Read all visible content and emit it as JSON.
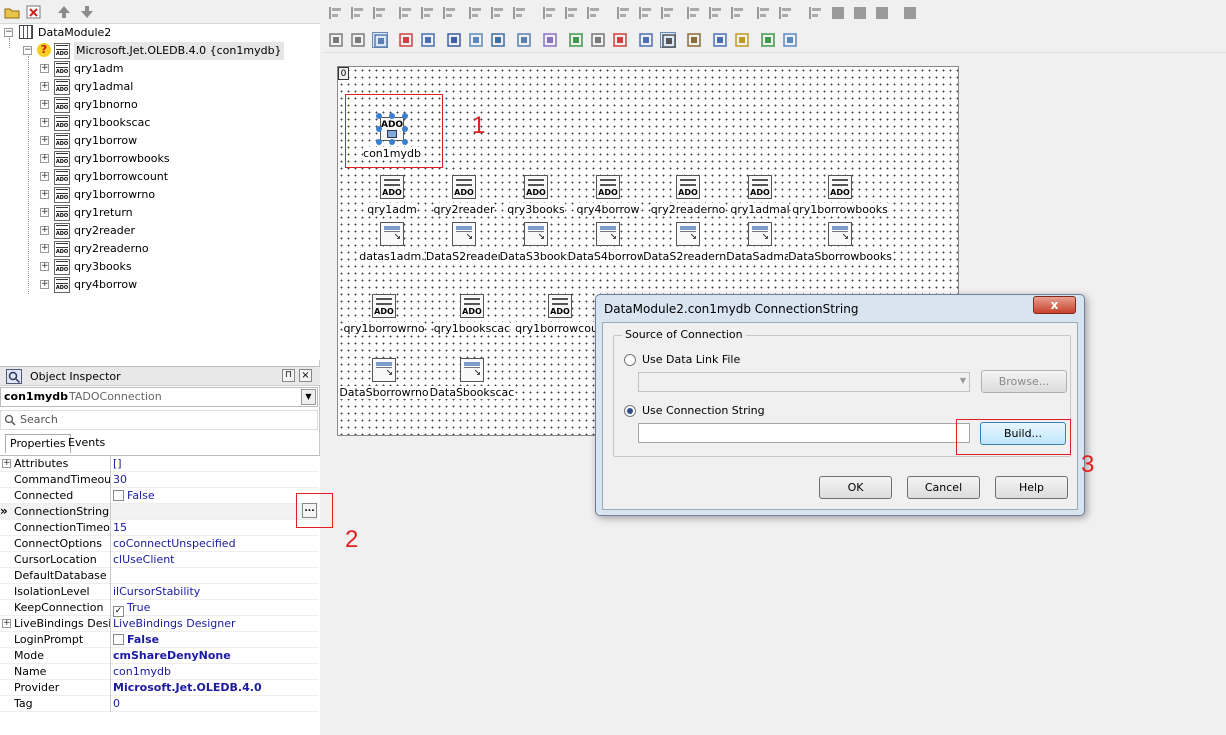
{
  "tree": {
    "root": "DataModule2",
    "connection": "Microsoft.Jet.OLEDB.4.0 {con1mydb}",
    "items": [
      "qry1adm",
      "qry1admal",
      "qry1bnorno",
      "qry1bookscac",
      "qry1borrow",
      "qry1borrowbooks",
      "qry1borrowcount",
      "qry1borrowrno",
      "qry1return",
      "qry2reader",
      "qry2readerno",
      "qry3books",
      "qry4borrow"
    ]
  },
  "inspector": {
    "title": "Object Inspector",
    "component_name": "con1mydb",
    "component_type": "TADOConnection",
    "search_placeholder": "Search",
    "tabs": [
      "Properties",
      "Events"
    ],
    "props": [
      {
        "name": "Attributes",
        "value": "[]",
        "expand": true
      },
      {
        "name": "CommandTimeout",
        "value": "30"
      },
      {
        "name": "Connected",
        "value": "False",
        "check": false
      },
      {
        "name": "ConnectionString",
        "value": "",
        "ellipsis": "...",
        "selected": true
      },
      {
        "name": "ConnectionTimeout",
        "value": "15"
      },
      {
        "name": "ConnectOptions",
        "value": "coConnectUnspecified"
      },
      {
        "name": "CursorLocation",
        "value": "clUseClient"
      },
      {
        "name": "DefaultDatabase",
        "value": ""
      },
      {
        "name": "IsolationLevel",
        "value": "ilCursorStability"
      },
      {
        "name": "KeepConnection",
        "value": "True",
        "check": true
      },
      {
        "name": "LiveBindings Designer",
        "value": "LiveBindings Designer",
        "expand": true
      },
      {
        "name": "LoginPrompt",
        "value": "False",
        "check": false,
        "bold": true
      },
      {
        "name": "Mode",
        "value": "cmShareDenyNone",
        "bold": true
      },
      {
        "name": "Name",
        "value": "con1mydb"
      },
      {
        "name": "Provider",
        "value": "Microsoft.Jet.OLEDB.4.0",
        "bold": true
      },
      {
        "name": "Tag",
        "value": "0"
      }
    ]
  },
  "designer": {
    "main_component": "con1mydb",
    "row1": [
      "qry1adm",
      "qry2reader",
      "qry3books",
      "qry4borrow",
      "qry2readerno",
      "qry1admal",
      "qry1borrowbooks"
    ],
    "row2": [
      "datas1adm.",
      "DataS2reader",
      "DataS3books",
      "DataS4borrow.",
      "DataS2readerno",
      "DataSadmal",
      "DataSborrowbooks"
    ],
    "row3": [
      "qry1borrowrno",
      "qry1bookscac",
      "qry1borrowcoun"
    ],
    "row4": [
      "DataSborrowrno",
      "DataSbookscac"
    ],
    "ado_text": "ADO",
    "form_marker": "0"
  },
  "annotations": [
    "1",
    "2",
    "3"
  ],
  "dialog": {
    "title": "DataModule2.con1mydb ConnectionString",
    "close": "x",
    "group": "Source of Connection",
    "option1": "Use Data Link File",
    "option2": "Use Connection String",
    "browse": "Browse...",
    "build": "Build...",
    "ok": "OK",
    "cancel": "Cancel",
    "help": "Help"
  },
  "colors": {
    "annotation": "#e02020",
    "selection": "#3c7fb1"
  }
}
